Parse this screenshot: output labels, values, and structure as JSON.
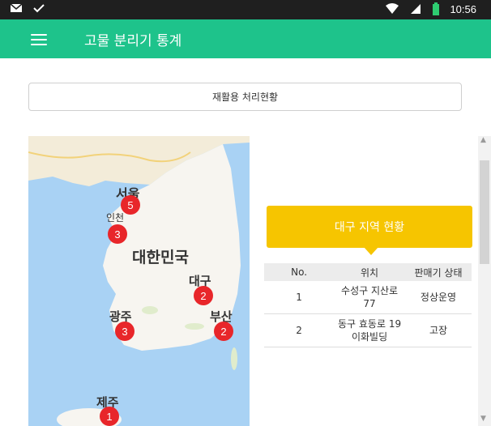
{
  "status_bar": {
    "time": "10:56"
  },
  "app_bar": {
    "title": "고물 분리기 통계"
  },
  "recycle_button": {
    "label": "재활용 처리현황"
  },
  "map": {
    "labels": {
      "seoul": "서울",
      "incheon": "인천",
      "korea": "대한민국",
      "daegu": "대구",
      "gwangju": "광주",
      "busan": "부산",
      "jeju": "제주"
    },
    "markers": {
      "seoul": "5",
      "incheon": "3",
      "daegu": "2",
      "gwangju": "3",
      "busan": "2",
      "jeju": "1"
    }
  },
  "region_panel": {
    "title": "대구 지역 현황"
  },
  "table": {
    "headers": [
      "No.",
      "위치",
      "판매기 상태"
    ],
    "rows": [
      [
        "1",
        "수성구 지산로 77",
        "정상운영"
      ],
      [
        "2",
        "동구 효동로 19 이화빌딩",
        "고장"
      ]
    ]
  },
  "colors": {
    "app_bar": "#1ec38b",
    "region_panel": "#f6c500",
    "marker": "#e8262a",
    "status_bar": "#1f1f1f"
  }
}
